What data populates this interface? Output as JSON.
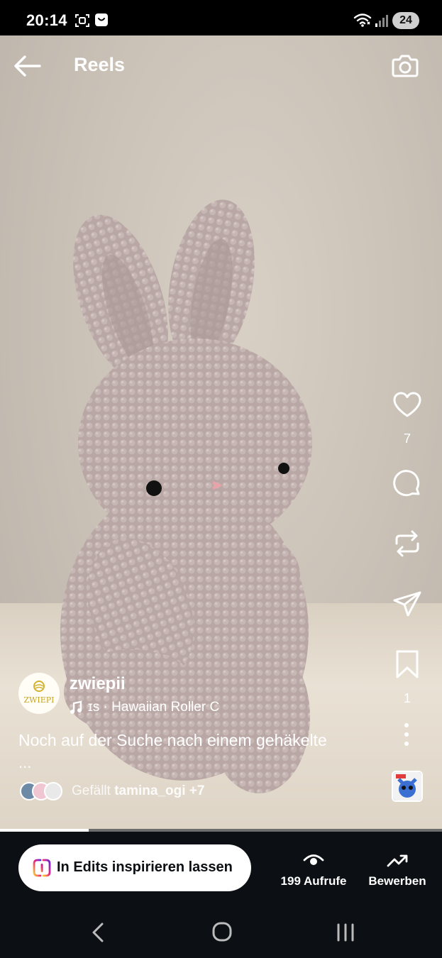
{
  "status_bar": {
    "time": "20:14",
    "battery": "24"
  },
  "header": {
    "title": "Reels"
  },
  "actions": {
    "likes_count": "7",
    "saves_count": "1"
  },
  "post": {
    "username": "zwiepii",
    "avatar_text": "ZWIEPI",
    "audio": "ɪs · Hawaiian Roller C",
    "caption": "Noch auf der Suche nach einem gehäkelte",
    "caption_more": "...",
    "liked_by_prefix": "Gefällt",
    "liked_by_user": "tamina_ogi",
    "liked_by_suffix": "+7"
  },
  "playback": {
    "progress": 0.2
  },
  "bottom_bar": {
    "edits_label": "In Edits inspirieren lassen",
    "views_label": "199 Aufrufe",
    "boost_label": "Bewerben"
  },
  "colors": {
    "panel": "#0c1014",
    "edits_gradient": [
      "#f9ce34",
      "#ee2a7b",
      "#6228d7"
    ]
  }
}
